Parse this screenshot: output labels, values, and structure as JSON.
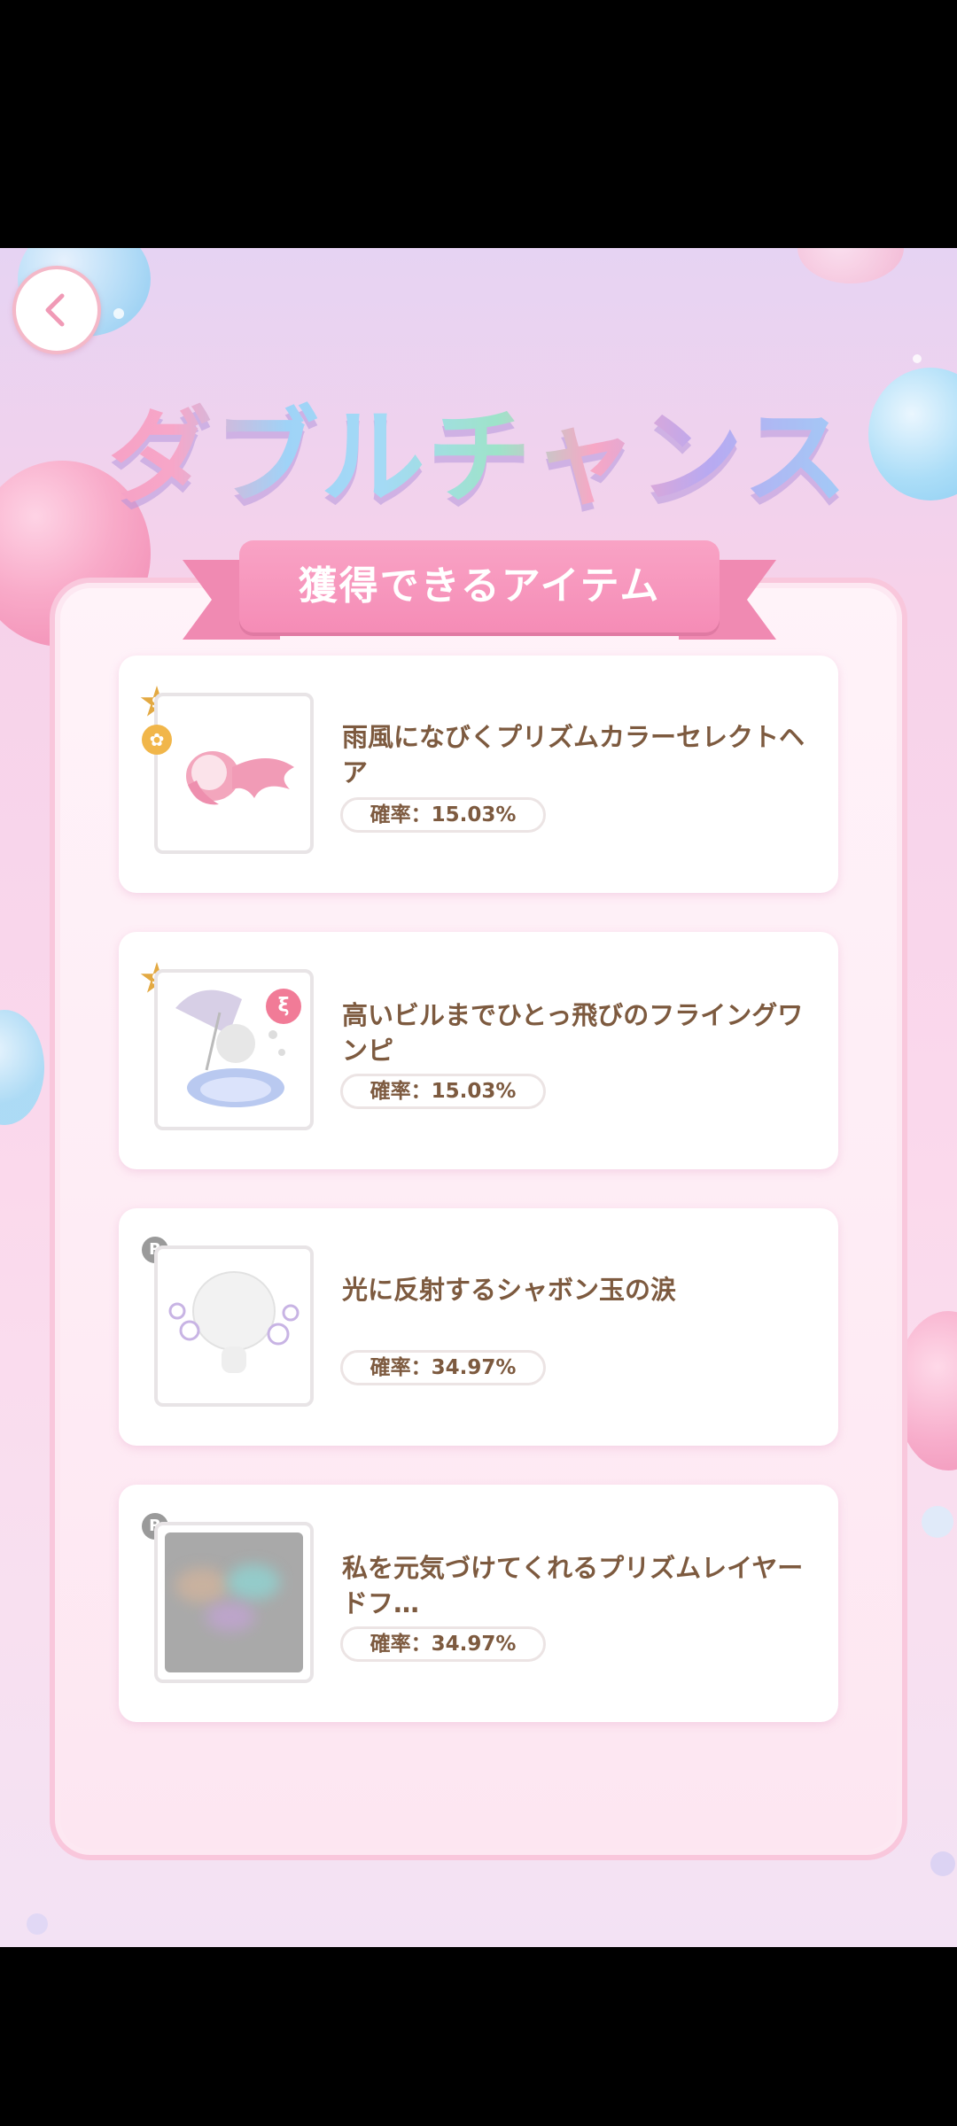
{
  "header": {
    "title": "ダブルチャンス",
    "back_icon": "chevron-left-icon"
  },
  "ribbon": {
    "label": "獲得できるアイテム"
  },
  "items": [
    {
      "rarity": "S",
      "name": "雨風になびくプリズムカラーセレクトヘア",
      "rate": "確率：15.03%",
      "icon": "pink-hair-icon"
    },
    {
      "rarity": "S",
      "name": "高いビルまでひとっ飛びのフライングワンピ",
      "rate": "確率：15.03%",
      "icon": "dress-umbrella-icon"
    },
    {
      "rarity": "R",
      "name": "光に反射するシャボン玉の涙",
      "rate": "確率：34.97%",
      "icon": "bubble-tears-icon"
    },
    {
      "rarity": "R",
      "name": "私を元気づけてくれるプリズムレイヤードフ…",
      "rate": "確率：34.97%",
      "icon": "blurred-item-icon"
    }
  ],
  "colors": {
    "title_pink": "#f49ac0",
    "title_blue": "#9fd3f7",
    "title_green": "#9ee3c9",
    "title_purple": "#b8a9f1",
    "ribbon": "#f58cb6",
    "text_brown": "#7d5a3f"
  }
}
